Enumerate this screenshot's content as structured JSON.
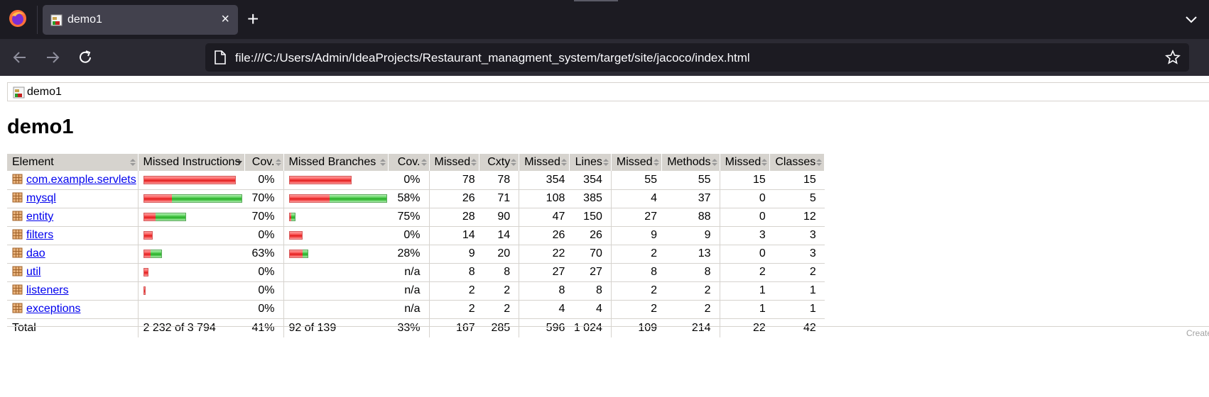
{
  "browser": {
    "tab_title": "demo1",
    "tab_close": "×",
    "new_tab": "+",
    "url": "file:///C:/Users/Admin/IdeaProjects/Restaurant_managment_system/target/site/jacoco/index.html"
  },
  "page": {
    "breadcrumb": "demo1",
    "title": "demo1",
    "footer": "Created"
  },
  "colors": {
    "missed_bar": "#e21e1e",
    "covered_bar": "#27ae27",
    "header_bg": "#d6d3ce",
    "link": "#0000ee"
  },
  "table": {
    "headers": {
      "element": "Element",
      "missed_instructions": "Missed Instructions",
      "cov_instructions": "Cov.",
      "missed_branches": "Missed Branches",
      "cov_branches": "Cov.",
      "missed_cxty": "Missed",
      "cxty": "Cxty",
      "missed_lines": "Missed",
      "lines": "Lines",
      "missed_methods": "Missed",
      "methods": "Methods",
      "missed_classes": "Missed",
      "classes": "Classes"
    },
    "rows": [
      {
        "name": "com.example.servlets",
        "instr_missed_fraction": 1.0,
        "instr_covered_fraction": 0.0,
        "instr_cov": "0%",
        "branch_missed_fraction": 0.64,
        "branch_covered_fraction": 0.0,
        "branch_cov": "0%",
        "missed_cxty": "78",
        "cxty": "78",
        "missed_lines": "354",
        "lines": "354",
        "missed_methods": "55",
        "methods": "55",
        "missed_classes": "15",
        "classes": "15"
      },
      {
        "name": "mysql",
        "instr_missed_fraction": 0.31,
        "instr_covered_fraction": 0.76,
        "instr_cov": "70%",
        "branch_missed_fraction": 0.41,
        "branch_covered_fraction": 0.59,
        "branch_cov": "58%",
        "missed_cxty": "26",
        "cxty": "71",
        "missed_lines": "108",
        "lines": "385",
        "missed_methods": "4",
        "methods": "37",
        "missed_classes": "0",
        "classes": "5"
      },
      {
        "name": "entity",
        "instr_missed_fraction": 0.13,
        "instr_covered_fraction": 0.33,
        "instr_cov": "70%",
        "branch_missed_fraction": 0.02,
        "branch_covered_fraction": 0.04,
        "branch_cov": "75%",
        "missed_cxty": "28",
        "cxty": "90",
        "missed_lines": "47",
        "lines": "150",
        "missed_methods": "27",
        "methods": "88",
        "missed_classes": "0",
        "classes": "12"
      },
      {
        "name": "filters",
        "instr_missed_fraction": 0.1,
        "instr_covered_fraction": 0.0,
        "instr_cov": "0%",
        "branch_missed_fraction": 0.14,
        "branch_covered_fraction": 0.0,
        "branch_cov": "0%",
        "missed_cxty": "14",
        "cxty": "14",
        "missed_lines": "26",
        "lines": "26",
        "missed_methods": "9",
        "methods": "9",
        "missed_classes": "3",
        "classes": "3"
      },
      {
        "name": "dao",
        "instr_missed_fraction": 0.08,
        "instr_covered_fraction": 0.12,
        "instr_cov": "63%",
        "branch_missed_fraction": 0.14,
        "branch_covered_fraction": 0.06,
        "branch_cov": "28%",
        "missed_cxty": "9",
        "cxty": "20",
        "missed_lines": "22",
        "lines": "70",
        "missed_methods": "2",
        "methods": "13",
        "missed_classes": "0",
        "classes": "3"
      },
      {
        "name": "util",
        "instr_missed_fraction": 0.05,
        "instr_covered_fraction": 0.0,
        "instr_cov": "0%",
        "branch_missed_fraction": 0.0,
        "branch_covered_fraction": 0.0,
        "branch_cov": "n/a",
        "missed_cxty": "8",
        "cxty": "8",
        "missed_lines": "27",
        "lines": "27",
        "missed_methods": "8",
        "methods": "8",
        "missed_classes": "2",
        "classes": "2"
      },
      {
        "name": "listeners",
        "instr_missed_fraction": 0.02,
        "instr_covered_fraction": 0.0,
        "instr_cov": "0%",
        "branch_missed_fraction": 0.0,
        "branch_covered_fraction": 0.0,
        "branch_cov": "n/a",
        "missed_cxty": "2",
        "cxty": "2",
        "missed_lines": "8",
        "lines": "8",
        "missed_methods": "2",
        "methods": "2",
        "missed_classes": "1",
        "classes": "1"
      },
      {
        "name": "exceptions",
        "instr_missed_fraction": 0.0,
        "instr_covered_fraction": 0.0,
        "instr_cov": "0%",
        "branch_missed_fraction": 0.0,
        "branch_covered_fraction": 0.0,
        "branch_cov": "n/a",
        "missed_cxty": "2",
        "cxty": "2",
        "missed_lines": "4",
        "lines": "4",
        "missed_methods": "2",
        "methods": "2",
        "missed_classes": "1",
        "classes": "1"
      }
    ],
    "total": {
      "label": "Total",
      "instr_missed": "2 232 of 3 794",
      "instr_cov": "41%",
      "branch_missed": "92 of 139",
      "branch_cov": "33%",
      "missed_cxty": "167",
      "cxty": "285",
      "missed_lines": "596",
      "lines": "1 024",
      "missed_methods": "109",
      "methods": "214",
      "missed_classes": "22",
      "classes": "42"
    }
  }
}
